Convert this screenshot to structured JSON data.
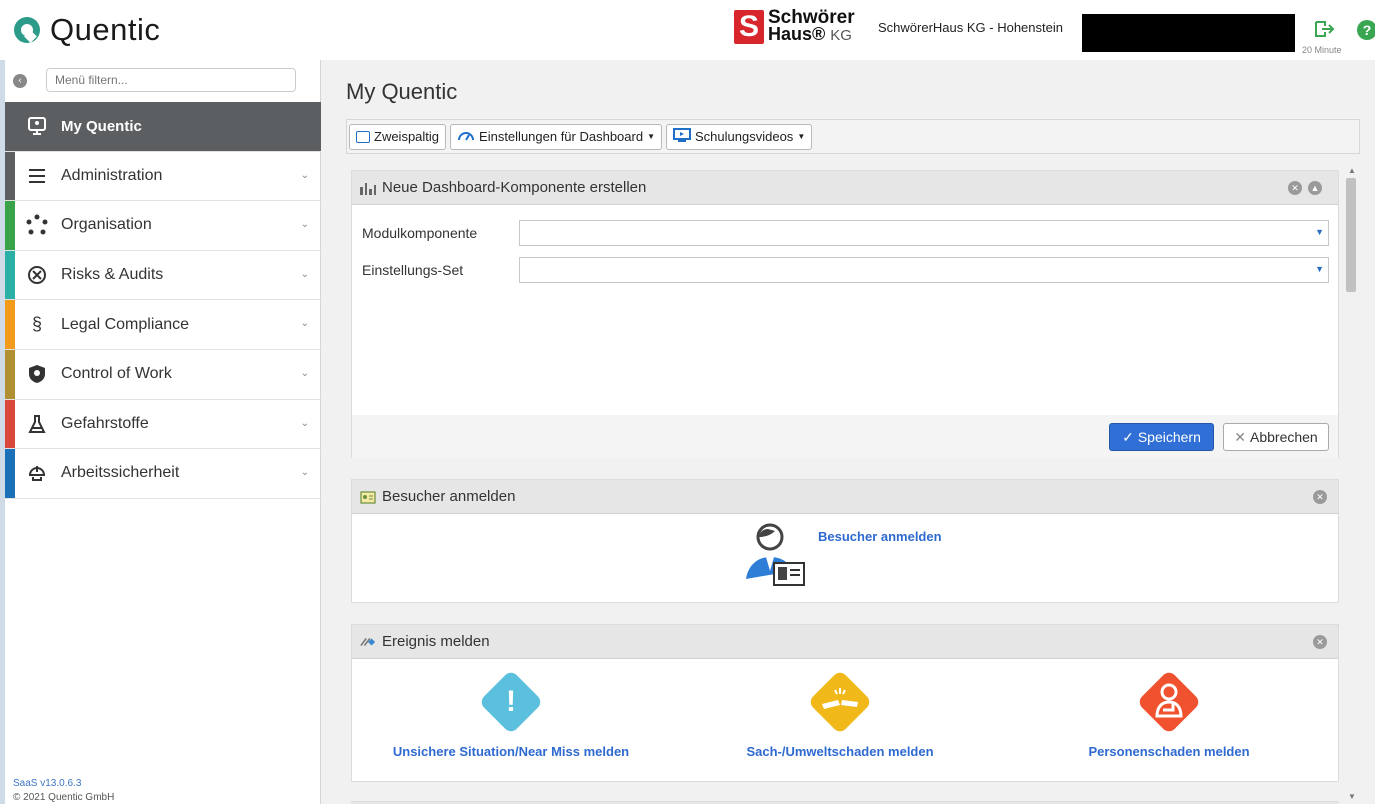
{
  "header": {
    "app_name": "Quentic",
    "brand_line1": "Schwörer",
    "brand_line2": "Haus®",
    "brand_line2_suffix": "KG",
    "company": "SchwörerHaus KG - Hohenstein",
    "timer": "20 Minute",
    "help": "?"
  },
  "sidebar": {
    "filter_placeholder": "Menü filtern...",
    "items": [
      {
        "label": "My Quentic",
        "icon": "monitor-icon",
        "color": "#5b5f62"
      },
      {
        "label": "Administration",
        "icon": "hamburger-icon",
        "color": "#5b5f62"
      },
      {
        "label": "Organisation",
        "icon": "network-icon",
        "color": "#3aa34a"
      },
      {
        "label": "Risks & Audits",
        "icon": "target-icon",
        "color": "#2ab0a5"
      },
      {
        "label": "Legal Compliance",
        "icon": "paragraph-icon",
        "color": "#f29a1c"
      },
      {
        "label": "Control of Work",
        "icon": "shield-icon",
        "color": "#b09030"
      },
      {
        "label": "Gefahrstoffe",
        "icon": "flask-icon",
        "color": "#d9483b"
      },
      {
        "label": "Arbeitssicherheit",
        "icon": "helmet-icon",
        "color": "#1c70b8"
      }
    ],
    "version": "SaaS v13.0.6.3",
    "copyright": "© 2021 Quentic GmbH"
  },
  "main": {
    "title": "My Quentic",
    "toolbar": {
      "two_column": "Zweispaltig",
      "dashboard_settings": "Einstellungen für Dashboard",
      "training_videos": "Schulungsvideos"
    },
    "dashboard_panel": {
      "title": "Neue Dashboard-Komponente erstellen",
      "field1_label": "Modulkomponente",
      "field2_label": "Einstellungs-Set",
      "save": "Speichern",
      "cancel": "Abbrechen"
    },
    "visitor_panel": {
      "title": "Besucher anmelden",
      "link": "Besucher anmelden"
    },
    "event_panel": {
      "title": "Ereignis melden",
      "items": [
        {
          "label": "Unsichere Situation/Near Miss melden",
          "color": "#5bc0de"
        },
        {
          "label": "Sach-/Umweltschaden melden",
          "color": "#f0b819"
        },
        {
          "label": "Personenschaden melden",
          "color": "#f0522f"
        }
      ]
    }
  }
}
